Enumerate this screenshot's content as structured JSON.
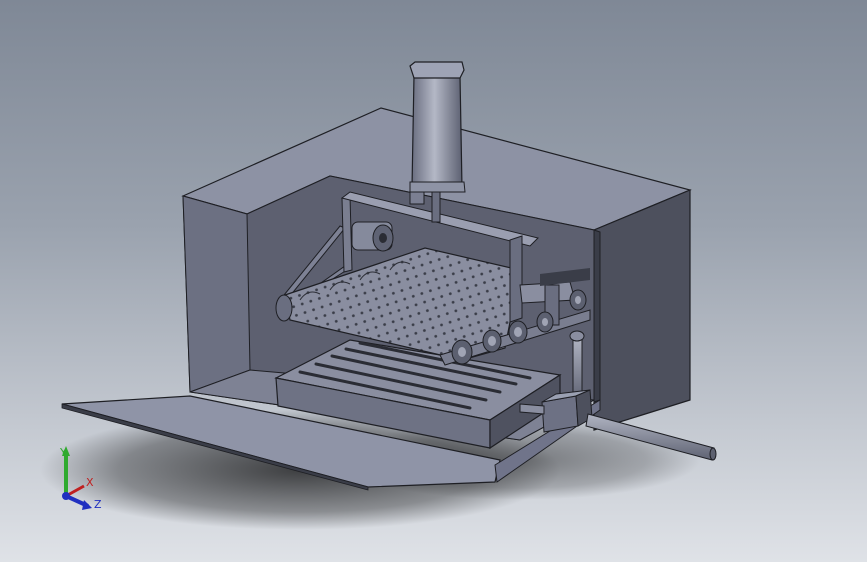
{
  "scene": {
    "background_top": "#7f8896",
    "background_bottom": "#dfe2e7",
    "body_color": "#7b7f92",
    "edge_color": "#1e1f24"
  },
  "triad": {
    "y_label": "Y",
    "x_label": "X",
    "z_label": "Z",
    "y_color": "#2faa2f",
    "x_color": "#c02020",
    "z_color": "#2030c0"
  }
}
